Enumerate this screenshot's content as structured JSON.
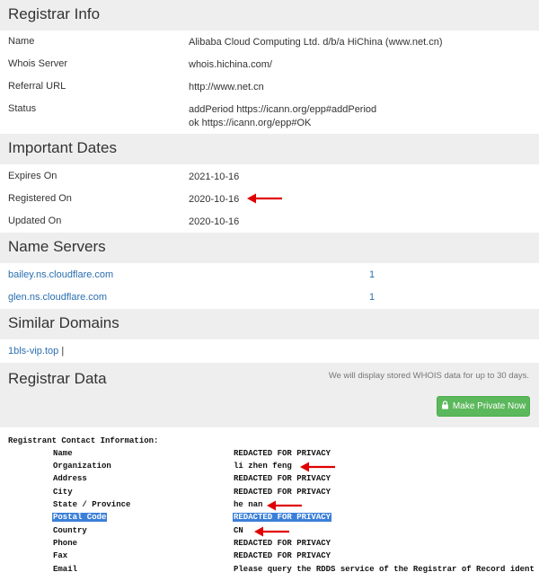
{
  "registrar_info": {
    "title": "Registrar Info",
    "rows": [
      {
        "label": "Name",
        "value": "Alibaba Cloud Computing Ltd. d/b/a HiChina (www.net.cn)"
      },
      {
        "label": "Whois Server",
        "value": "whois.hichina.com/"
      },
      {
        "label": "Referral URL",
        "value": "http://www.net.cn"
      },
      {
        "label": "Status",
        "value": "addPeriod https://icann.org/epp#addPeriod",
        "value2": "ok https://icann.org/epp#OK"
      }
    ]
  },
  "important_dates": {
    "title": "Important Dates",
    "rows": [
      {
        "label": "Expires On",
        "value": "2021-10-16"
      },
      {
        "label": "Registered On",
        "value": "2020-10-16"
      },
      {
        "label": "Updated On",
        "value": "2020-10-16"
      }
    ]
  },
  "name_servers": {
    "title": "Name Servers",
    "rows": [
      {
        "host": "bailey.ns.cloudflare.com",
        "count": "1"
      },
      {
        "host": "glen.ns.cloudflare.com",
        "count": "1"
      }
    ]
  },
  "similar_domains": {
    "title": "Similar Domains",
    "link": "1bls-vip.top",
    "separator": "|"
  },
  "registrar_data": {
    "title": "Registrar Data",
    "note": "We will display stored WHOIS data for up to 30 days.",
    "button_label": "Make Private Now",
    "button_icon": "lock-icon"
  },
  "whois": {
    "heading": "Registrant Contact Information:",
    "rows": [
      {
        "key": "Name",
        "value": "REDACTED FOR PRIVACY"
      },
      {
        "key": "Organization",
        "value": "li zhen feng"
      },
      {
        "key": "Address",
        "value": "REDACTED FOR PRIVACY"
      },
      {
        "key": "City",
        "value": "REDACTED FOR PRIVACY"
      },
      {
        "key": "State / Province",
        "value": "he nan"
      },
      {
        "key": "Postal Code",
        "value": "REDACTED FOR PRIVACY"
      },
      {
        "key": "Country",
        "value": "CN"
      },
      {
        "key": "Phone",
        "value": "REDACTED FOR PRIVACY"
      },
      {
        "key": "Fax",
        "value": "REDACTED FOR PRIVACY"
      },
      {
        "key": "Email",
        "value": "Please query the RDDS service of the Registrar of Record  ident"
      }
    ]
  },
  "colors": {
    "arrow": "#e00000",
    "highlight": "#3b7fd8",
    "button": "#5cb85c",
    "link": "#2a6fb0"
  }
}
